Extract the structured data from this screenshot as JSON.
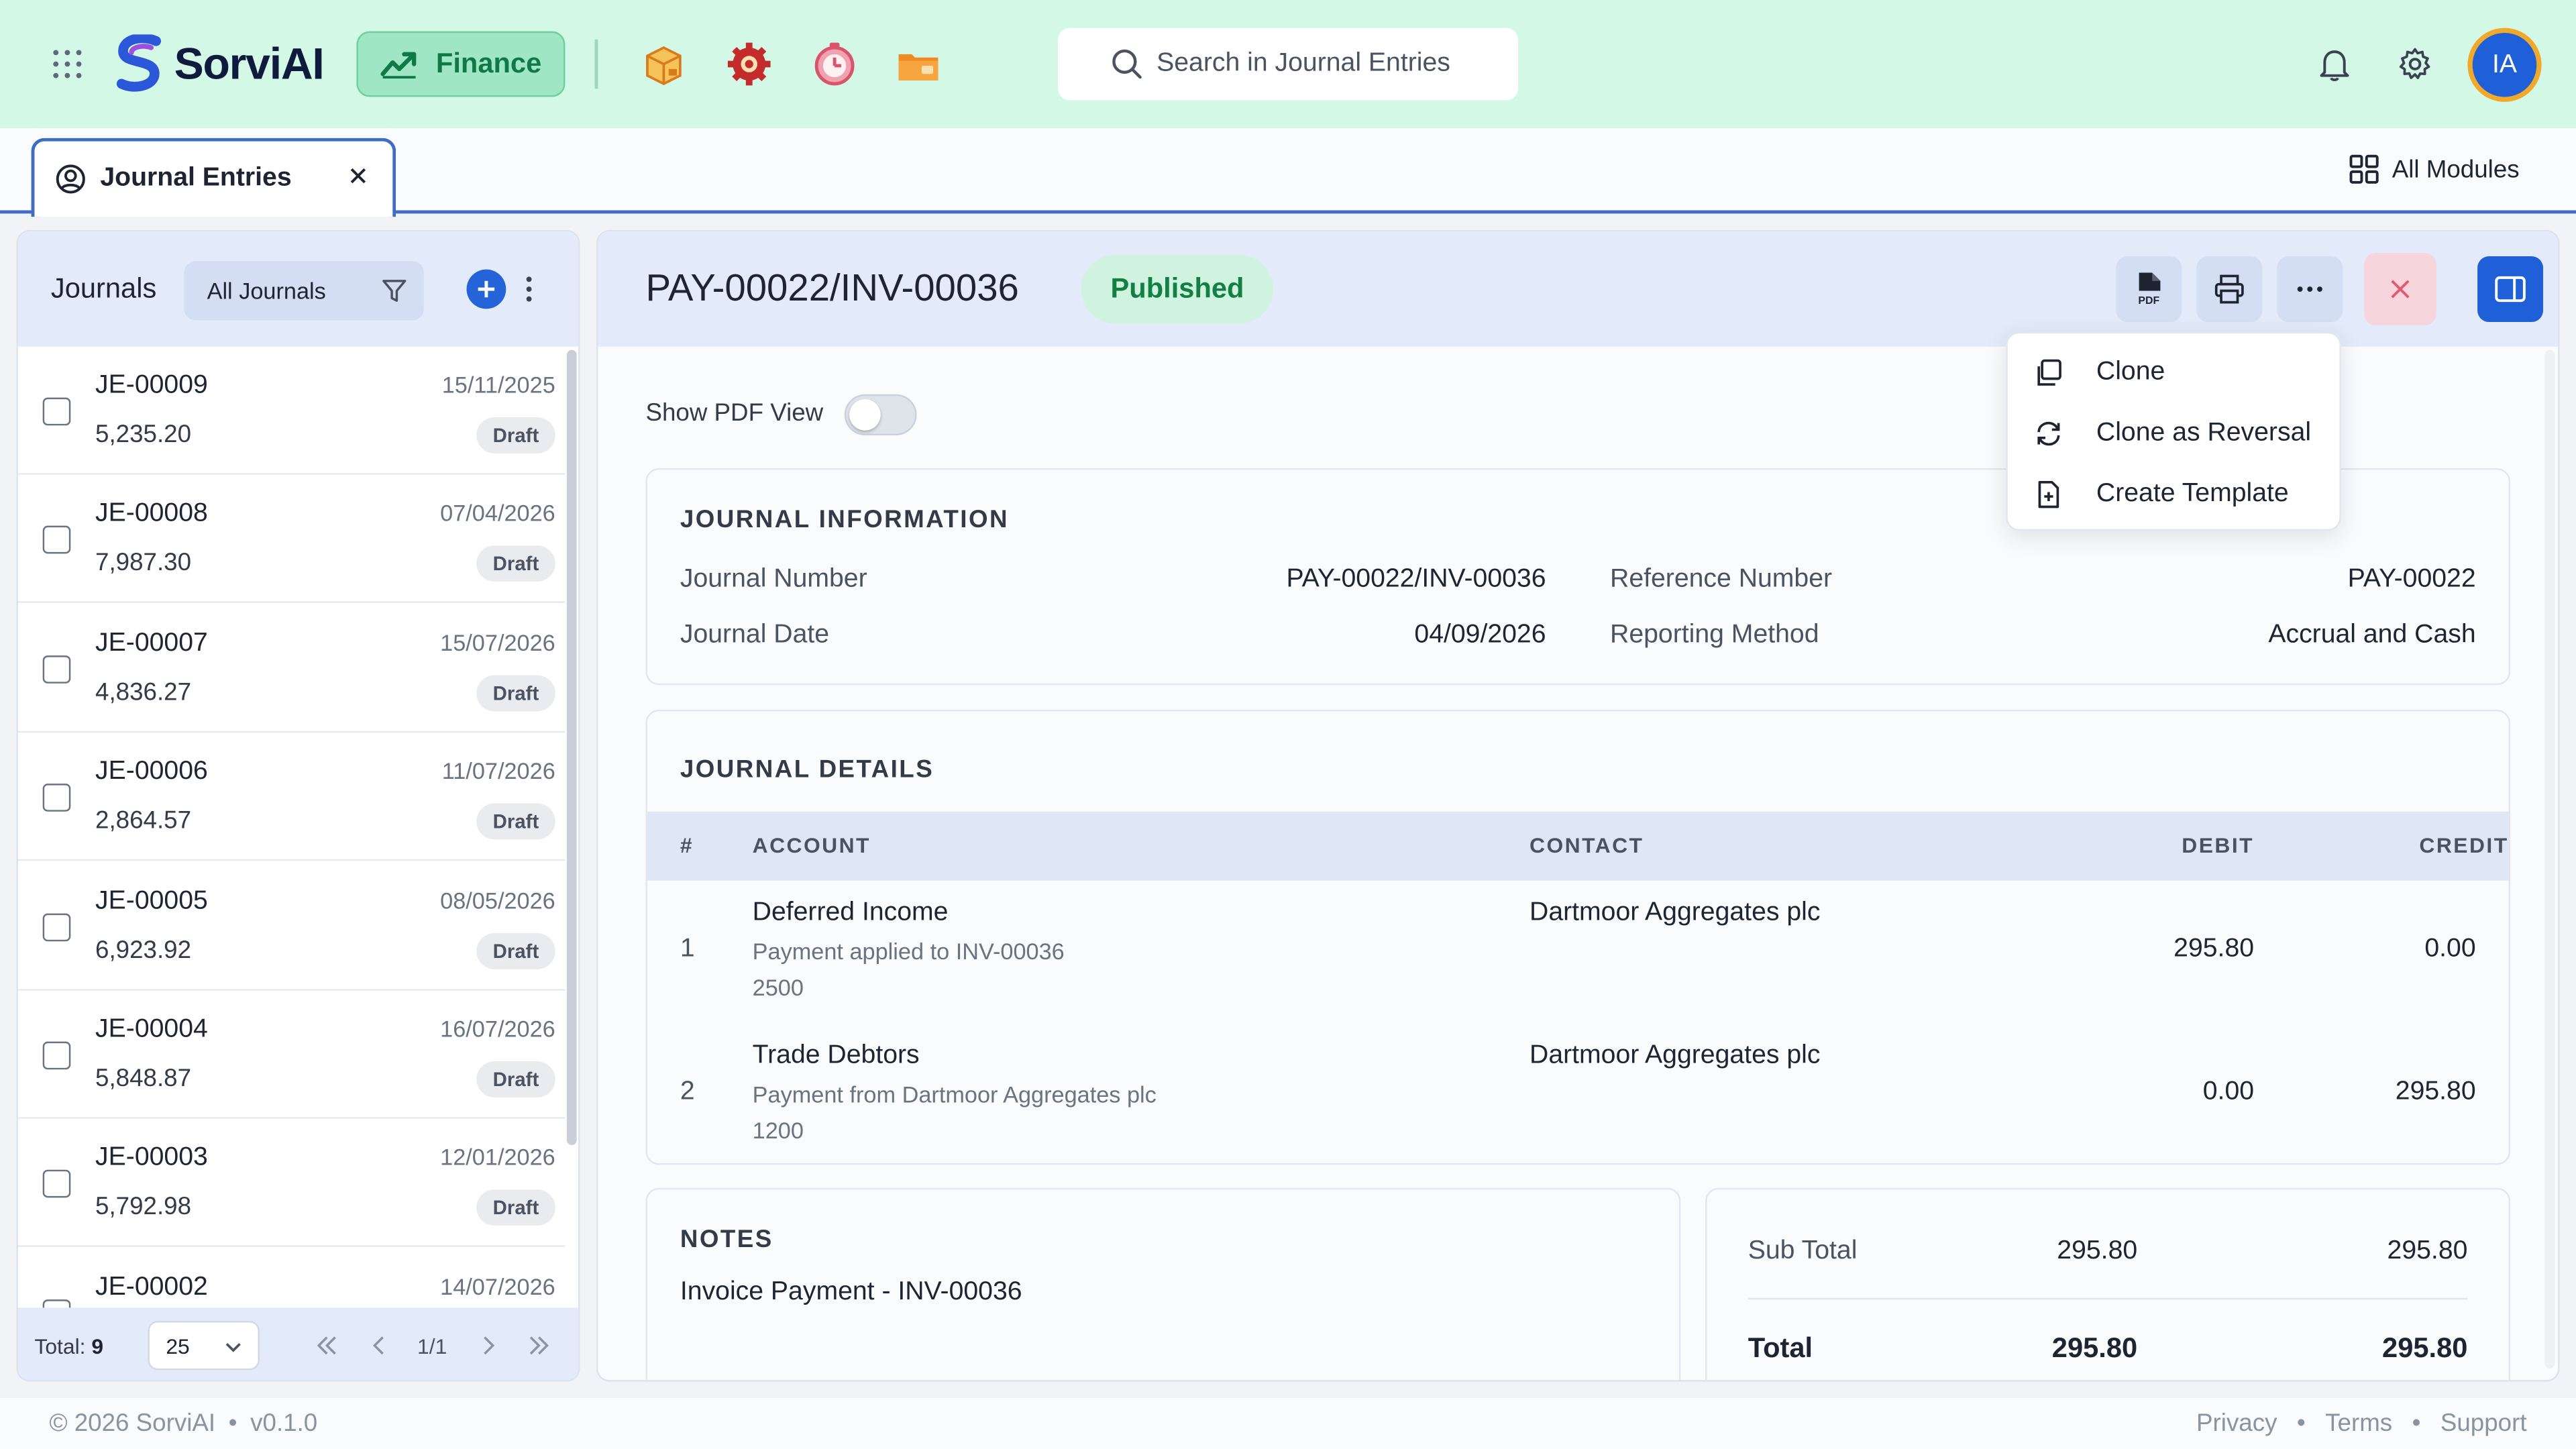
{
  "app": {
    "name": "SorviAI",
    "module": "Finance"
  },
  "header": {
    "search_placeholder": "Search in Journal Entries",
    "avatar_initials": "IA",
    "icons": [
      "apps-grid-icon",
      "finance-chart-icon",
      "box-app-icon",
      "gear-app-icon",
      "clock-app-icon",
      "folder-app-icon",
      "search-icon",
      "bell-icon",
      "settings-gear-icon"
    ]
  },
  "tabs": [
    {
      "label": "Journal Entries"
    }
  ],
  "all_modules": "All Modules",
  "sidebar": {
    "title": "Journals",
    "filter": "All Journals",
    "items": [
      {
        "id": "JE-00009",
        "amount": "5,235.20",
        "date": "15/11/2025",
        "status": "Draft"
      },
      {
        "id": "JE-00008",
        "amount": "7,987.30",
        "date": "07/04/2026",
        "status": "Draft"
      },
      {
        "id": "JE-00007",
        "amount": "4,836.27",
        "date": "15/07/2026",
        "status": "Draft"
      },
      {
        "id": "JE-00006",
        "amount": "2,864.57",
        "date": "11/07/2026",
        "status": "Draft"
      },
      {
        "id": "JE-00005",
        "amount": "6,923.92",
        "date": "08/05/2026",
        "status": "Draft"
      },
      {
        "id": "JE-00004",
        "amount": "5,848.87",
        "date": "16/07/2026",
        "status": "Draft"
      },
      {
        "id": "JE-00003",
        "amount": "5,792.98",
        "date": "12/01/2026",
        "status": "Draft"
      },
      {
        "id": "JE-00002",
        "amount": "",
        "date": "14/07/2026",
        "status": ""
      }
    ],
    "footer": {
      "total_label": "Total:",
      "total_value": "9",
      "page_size": "25",
      "page": "1/1"
    }
  },
  "detail": {
    "title": "PAY-00022/INV-00036",
    "status": "Published",
    "pdf_toggle_label": "Show PDF View",
    "pdf_toggle_on": false,
    "menu": {
      "clone": "Clone",
      "clone_reversal": "Clone as Reversal",
      "create_template": "Create Template"
    },
    "info": {
      "section_title": "JOURNAL INFORMATION",
      "journal_number_label": "Journal Number",
      "journal_number": "PAY-00022/INV-00036",
      "journal_date_label": "Journal Date",
      "journal_date": "04/09/2026",
      "reference_label": "Reference Number",
      "reference": "PAY-00022",
      "reporting_label": "Reporting Method",
      "reporting": "Accrual and Cash"
    },
    "details": {
      "section_title": "JOURNAL DETAILS",
      "columns": {
        "num": "#",
        "account": "ACCOUNT",
        "contact": "CONTACT",
        "debit": "DEBIT",
        "credit": "CREDIT"
      },
      "rows": [
        {
          "num": "1",
          "account": "Deferred Income",
          "description": "Payment applied to INV-00036",
          "code": "2500",
          "contact": "Dartmoor Aggregates plc",
          "debit": "295.80",
          "credit": "0.00"
        },
        {
          "num": "2",
          "account": "Trade Debtors",
          "description": "Payment from Dartmoor Aggregates plc",
          "code": "1200",
          "contact": "Dartmoor Aggregates plc",
          "debit": "0.00",
          "credit": "295.80"
        }
      ]
    },
    "notes": {
      "title": "NOTES",
      "text": "Invoice Payment - INV-00036"
    },
    "totals": {
      "subtotal_label": "Sub Total",
      "subtotal_debit": "295.80",
      "subtotal_credit": "295.80",
      "total_label": "Total",
      "total_debit": "295.80",
      "total_credit": "295.80"
    }
  },
  "footer": {
    "copyright": "© 2026 SorviAI",
    "version": "v0.1.0",
    "links": [
      "Privacy",
      "Terms",
      "Support"
    ]
  },
  "colors": {
    "topbar": "#d4f8e6",
    "accent": "#1f5fd8",
    "published": "#128043",
    "panel_header": "#e3ebfa"
  }
}
